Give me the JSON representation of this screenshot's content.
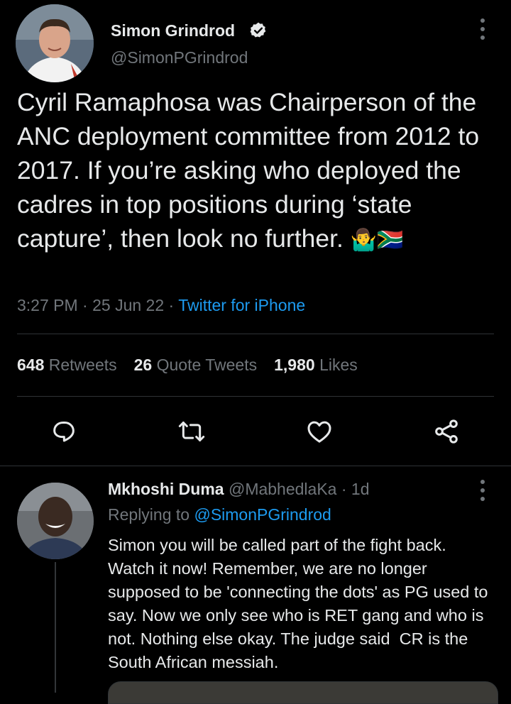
{
  "tweet": {
    "author_name": "Simon Grindrod",
    "author_handle": "@SimonPGrindrod",
    "text": "Cyril Ramaphosa was Chairperson of the ANC deployment committee from 2012 to 2017. If you’re asking who deployed the cadres in top positions during ‘state capture’, then look no further.",
    "emoji": "🤷‍♂️🇿🇦",
    "time": "3:27 PM",
    "sep1": "·",
    "date": "25 Jun 22",
    "sep2": "·",
    "source": "Twitter for iPhone",
    "stats": {
      "retweets_count": "648",
      "retweets_label": "Retweets",
      "quotes_count": "26",
      "quotes_label": "Quote Tweets",
      "likes_count": "1,980",
      "likes_label": "Likes"
    },
    "actions": [
      "reply-icon",
      "retweet-icon",
      "like-icon",
      "share-icon"
    ]
  },
  "reply": {
    "author_name": "Mkhoshi Duma",
    "author_handle": "@MabhedlaKa",
    "sep": "·",
    "age": "1d",
    "replying_prefix": "Replying to",
    "replying_to": "@SimonPGrindrod",
    "text": "Simon you will be called part of the fight back. Watch it now! Remember, we are no longer supposed to be 'connecting the dots' as PG used to say. Now we only see who is RET gang and who is not. Nothing else okay. The judge said  CR is the South African messiah."
  },
  "colors": {
    "background": "#000000",
    "text": "#e7e9ea",
    "secondary": "#71767b",
    "accent": "#1d9bf0",
    "divider": "#2f3336"
  }
}
